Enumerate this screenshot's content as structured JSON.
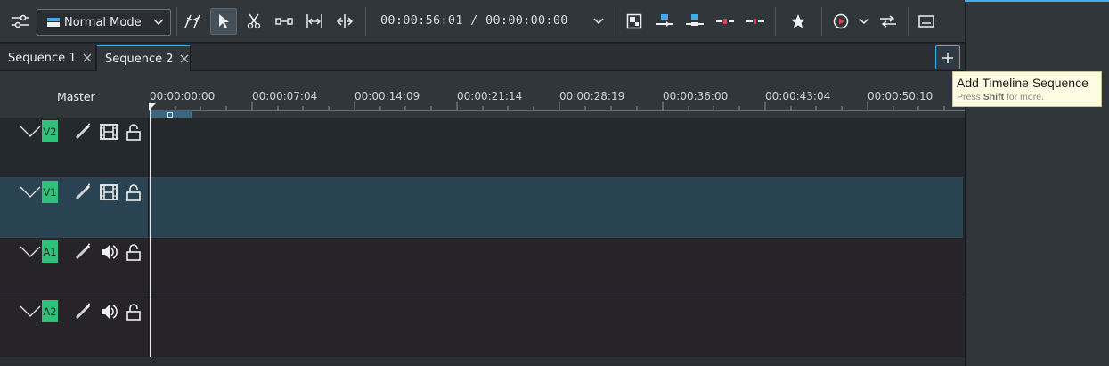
{
  "toolbar": {
    "mode_label": "Normal Mode",
    "timecode_current": "00:00:56:01",
    "timecode_separator": "/",
    "timecode_total": "00:00:00:00"
  },
  "tabs": [
    {
      "label": "Sequence 1",
      "selected": false
    },
    {
      "label": "Sequence 2",
      "selected": true
    }
  ],
  "tooltip": {
    "title": "Add Timeline Sequence",
    "hint_prefix": "Press ",
    "hint_key": "Shift",
    "hint_suffix": " for more."
  },
  "timeline": {
    "master_label": "Master",
    "ruler_labels": [
      "00:00:00:00",
      "00:00:07:04",
      "00:00:14:09",
      "00:00:21:14",
      "00:00:28:19",
      "00:00:36:00",
      "00:00:43:04",
      "00:00:50:10"
    ],
    "tracks": [
      {
        "tag": "V2",
        "kind": "video",
        "selected": false
      },
      {
        "tag": "V1",
        "kind": "video",
        "selected": true
      },
      {
        "tag": "A1",
        "kind": "audio",
        "selected": false
      },
      {
        "tag": "A2",
        "kind": "audio",
        "selected": false
      }
    ]
  },
  "colors": {
    "accent": "#3daee9",
    "track_tag": "#2fc17a",
    "selected_track": "#2a4352",
    "video_track_bg": "#24292d",
    "audio_track_bg": "#262429"
  },
  "icons": [
    "settings-sliders-icon",
    "normal-mode-icon",
    "spacer-icon",
    "select-icon",
    "razor-icon",
    "slip-icon",
    "ripple-icon",
    "multicam-icon",
    "composition-icon",
    "insert-icon",
    "overwrite-icon",
    "lift-icon",
    "extract-icon",
    "favorite-star-icon",
    "preview-render-icon",
    "mixer-icon",
    "subtitle-icon"
  ]
}
